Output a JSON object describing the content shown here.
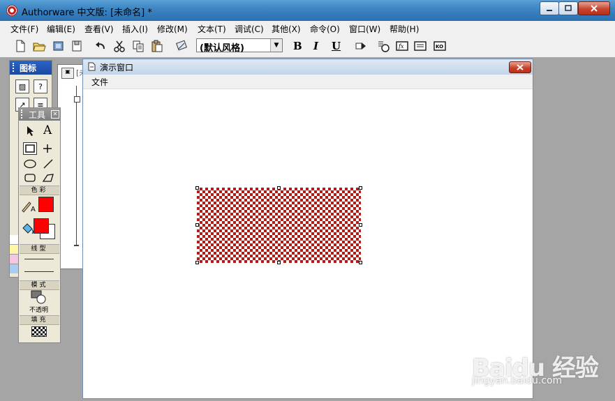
{
  "window": {
    "title": "Authorware 中文版: [未命名] *"
  },
  "menu": [
    "文件(F)",
    "编辑(E)",
    "查看(V)",
    "插入(I)",
    "修改(M)",
    "文本(T)",
    "调试(C)",
    "其他(X)",
    "命令(O)",
    "窗口(W)",
    "帮助(H)"
  ],
  "toolbar": {
    "style_select": "(默认风格)",
    "bold": "B",
    "italic": "I",
    "underline": "U",
    "fx": "fx",
    "ko": "KO"
  },
  "icon_palette": {
    "title": "图标"
  },
  "flow_window": {
    "title_fragment": "[未"
  },
  "tools_palette": {
    "title": "工具",
    "text_tool": "A",
    "sections": {
      "color": "色彩",
      "line": "线型",
      "mode": "模式",
      "fill": "填充"
    },
    "mode_value": "不透明",
    "pen_color": "#ff0000",
    "fill_color": "#ff0000"
  },
  "presentation_window": {
    "title": "演示窗口",
    "menu": [
      "文件"
    ]
  },
  "shape": {
    "fill_pattern": "checker",
    "color": "#b51a14"
  },
  "watermark": {
    "logo": "Baidu 经验",
    "url": "jingyan.baidu.com"
  }
}
